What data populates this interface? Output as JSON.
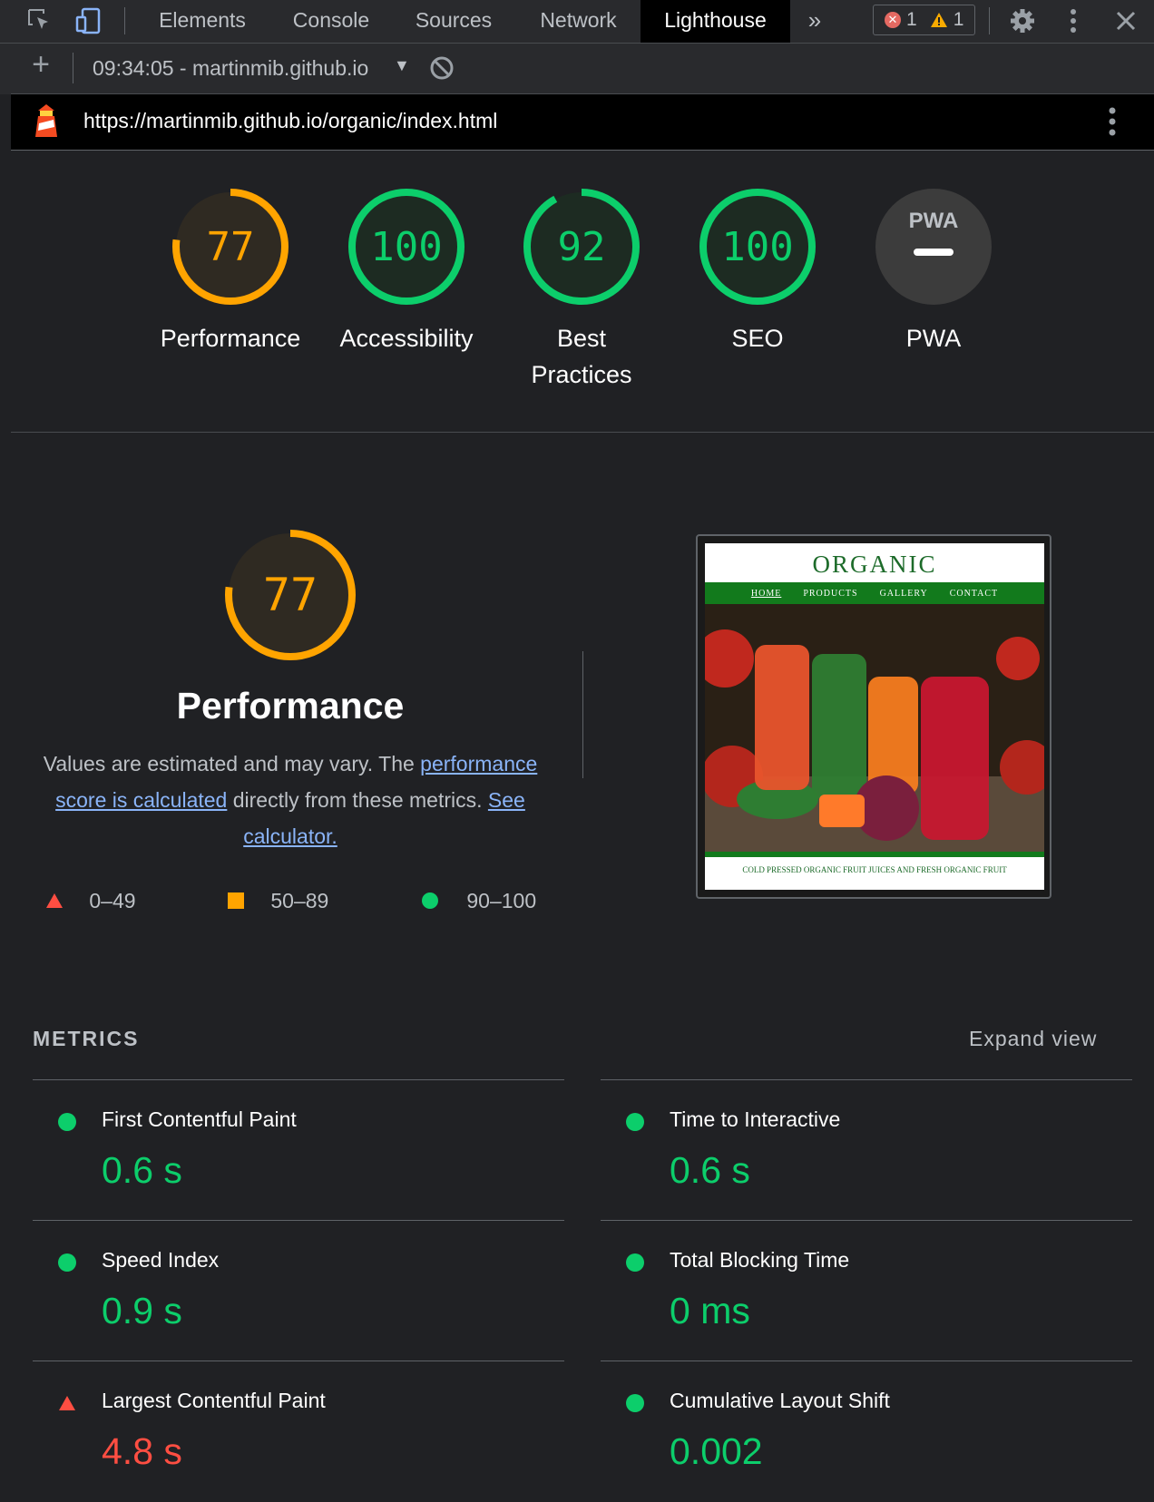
{
  "devtools": {
    "tabs": [
      {
        "label": "Elements",
        "active": false
      },
      {
        "label": "Console",
        "active": false
      },
      {
        "label": "Sources",
        "active": false
      },
      {
        "label": "Network",
        "active": false
      },
      {
        "label": "Lighthouse",
        "active": true
      }
    ],
    "more_tabs_glyph": "»",
    "issues": {
      "errors": "1",
      "warnings": "1"
    }
  },
  "report_toolbar": {
    "report_select": "09:34:05 - martinmib.github.io",
    "add_glyph": "+"
  },
  "url_bar": {
    "url": "https://martinmib.github.io/organic/index.html"
  },
  "gauges": [
    {
      "score": "77",
      "label": "Performance",
      "status": "average",
      "color": "#ffa400",
      "fraction": 0.77
    },
    {
      "score": "100",
      "label": "Accessibility",
      "status": "pass",
      "color": "#0cce6b",
      "fraction": 1.0
    },
    {
      "score": "92",
      "label_line1": "Best",
      "label_line2": "Practices",
      "status": "pass",
      "color": "#0cce6b",
      "fraction": 0.92
    },
    {
      "score": "100",
      "label": "SEO",
      "status": "pass",
      "color": "#0cce6b",
      "fraction": 1.0
    },
    {
      "badge": "PWA",
      "label": "PWA",
      "status": "not-applicable"
    }
  ],
  "performance": {
    "score": "77",
    "fraction": 0.77,
    "title": "Performance",
    "desc_part1": "Values are estimated and may vary. The ",
    "desc_link1": "performance score is calculated",
    "desc_part2": " directly from these metrics. ",
    "desc_link2": "See calculator.",
    "legend": [
      {
        "range": "0–49",
        "shape": "triangle",
        "color": "#ff4e42"
      },
      {
        "range": "50–89",
        "shape": "square",
        "color": "#ffa400"
      },
      {
        "range": "90–100",
        "shape": "circle",
        "color": "#0cce6b"
      }
    ]
  },
  "screenshot": {
    "site_title": "ORGANIC",
    "nav": [
      "HOME",
      "PRODUCTS",
      "GALLERY",
      "CONTACT"
    ],
    "footer": "COLD PRESSED ORGANIC FRUIT JUICES AND FRESH ORGANIC FRUIT"
  },
  "metrics": {
    "heading": "METRICS",
    "expand_label": "Expand view",
    "items": [
      {
        "label": "First Contentful Paint",
        "value": "0.6 s",
        "status": "pass"
      },
      {
        "label": "Time to Interactive",
        "value": "0.6 s",
        "status": "pass"
      },
      {
        "label": "Speed Index",
        "value": "0.9 s",
        "status": "pass"
      },
      {
        "label": "Total Blocking Time",
        "value": "0 ms",
        "status": "pass"
      },
      {
        "label": "Largest Contentful Paint",
        "value": "4.8 s",
        "status": "fail"
      },
      {
        "label": "Cumulative Layout Shift",
        "value": "0.002",
        "status": "pass"
      }
    ]
  },
  "colors": {
    "pass": "#0cce6b",
    "average": "#ffa400",
    "fail": "#ff4e42",
    "link": "#8ab4f8"
  }
}
